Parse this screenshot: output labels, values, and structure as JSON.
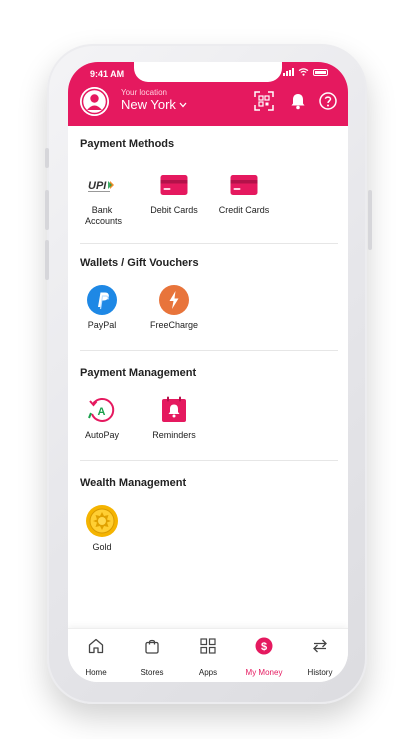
{
  "status_bar": {
    "time": "9:41 AM"
  },
  "header": {
    "location_label": "Your location",
    "location_city": "New York",
    "icons": [
      "qr-code-icon",
      "bell-icon",
      "help-icon"
    ]
  },
  "sections": [
    {
      "title": "Payment Methods",
      "items": [
        {
          "label": "Bank Accounts",
          "icon": "upi-icon"
        },
        {
          "label": "Debit Cards",
          "icon": "card-icon"
        },
        {
          "label": "Credit Cards",
          "icon": "card-icon"
        }
      ]
    },
    {
      "title": "Wallets / Gift Vouchers",
      "items": [
        {
          "label": "PayPal",
          "icon": "paypal-icon"
        },
        {
          "label": "FreeCharge",
          "icon": "freecharge-icon"
        }
      ]
    },
    {
      "title": "Payment Management",
      "items": [
        {
          "label": "AutoPay",
          "icon": "autopay-icon"
        },
        {
          "label": "Reminders",
          "icon": "reminder-icon"
        }
      ]
    },
    {
      "title": "Wealth Management",
      "items": [
        {
          "label": "Gold",
          "icon": "gold-icon"
        }
      ]
    }
  ],
  "upi_text": "UPI",
  "bottom_nav": [
    {
      "label": "Home",
      "icon": "home-icon"
    },
    {
      "label": "Stores",
      "icon": "bag-icon"
    },
    {
      "label": "Apps",
      "icon": "grid-icon"
    },
    {
      "label": "My Money",
      "icon": "rupee-icon",
      "active": true
    },
    {
      "label": "History",
      "icon": "swap-icon"
    }
  ],
  "colors": {
    "brand": "#e5195f",
    "paypal": "#1e88e5",
    "freecharge": "#e8743b",
    "gold": "#f5b400"
  }
}
